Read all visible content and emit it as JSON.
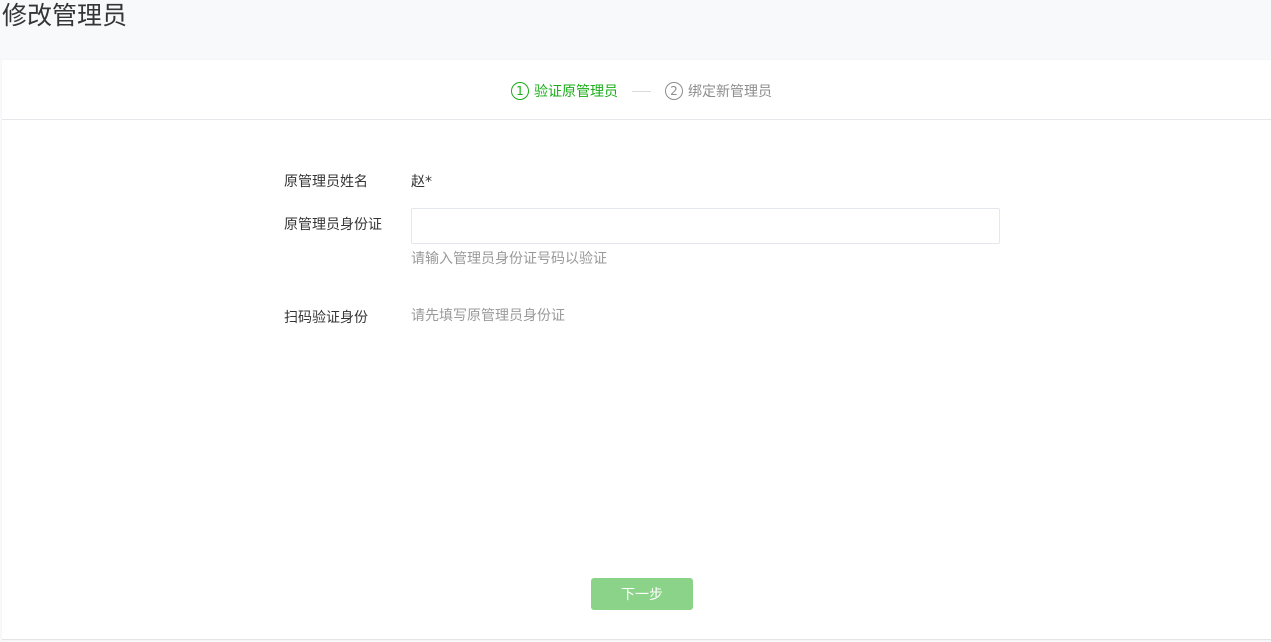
{
  "page": {
    "title": "修改管理员"
  },
  "steps": [
    {
      "number": "1",
      "label": "验证原管理员",
      "active": true
    },
    {
      "number": "2",
      "label": "绑定新管理员",
      "active": false
    }
  ],
  "form": {
    "admin_name": {
      "label": "原管理员姓名",
      "value": "赵*"
    },
    "admin_id": {
      "label": "原管理员身份证",
      "value": "",
      "tip": "请输入管理员身份证号码以验证"
    },
    "scan": {
      "label": "扫码验证身份",
      "value": "请先填写原管理员身份证"
    }
  },
  "footer": {
    "next_label": "下一步"
  },
  "colors": {
    "accent": "#1aad19",
    "button_disabled": "#8ad389",
    "muted_text": "#9a9a9a"
  }
}
